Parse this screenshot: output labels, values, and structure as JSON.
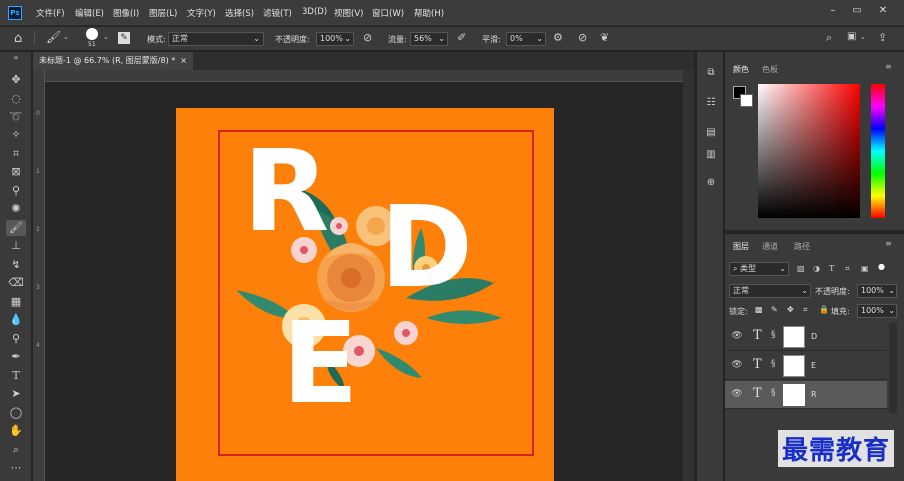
{
  "app": {
    "logo": "Ps"
  },
  "menu": [
    "文件(F)",
    "编辑(E)",
    "图像(I)",
    "图层(L)",
    "文字(Y)",
    "选择(S)",
    "滤镜(T)",
    "3D(D)",
    "视图(V)",
    "窗口(W)",
    "帮助(H)"
  ],
  "window_controls": {
    "minimize": "–",
    "restore": "▭",
    "close": "✕"
  },
  "options": {
    "brush_size": "51",
    "mode_label": "模式:",
    "mode_value": "正常",
    "opacity_label": "不透明度:",
    "opacity_value": "100%",
    "flow_label": "流量:",
    "flow_value": "56%",
    "smooth_label": "平滑:",
    "smooth_value": "0%"
  },
  "document": {
    "tab_title": "未标题-1 @ 66.7% (R, 图层蒙版/8) *",
    "close": "×"
  },
  "ruler": {
    "marks": [
      "0",
      "1",
      "2",
      "3",
      "4"
    ]
  },
  "artwork": {
    "letter1": "R",
    "letter2": "D",
    "letter3": "E",
    "bg_color": "#fc8009",
    "frame_color": "#d8241f"
  },
  "color_panel": {
    "tab_color": "颜色",
    "tab_swatches": "色板"
  },
  "layers_panel": {
    "tab_layers": "图层",
    "tab_channels": "通道",
    "tab_paths": "路径",
    "filter_label": "类型",
    "blend_mode": "正常",
    "opacity_label": "不透明度:",
    "opacity_value": "100%",
    "lock_label": "锁定:",
    "fill_label": "填充:",
    "fill_value": "100%",
    "layers": [
      {
        "type": "T",
        "name": "D"
      },
      {
        "type": "T",
        "name": "E"
      },
      {
        "type": "T",
        "name": "R"
      }
    ]
  },
  "watermark": "最需教育"
}
